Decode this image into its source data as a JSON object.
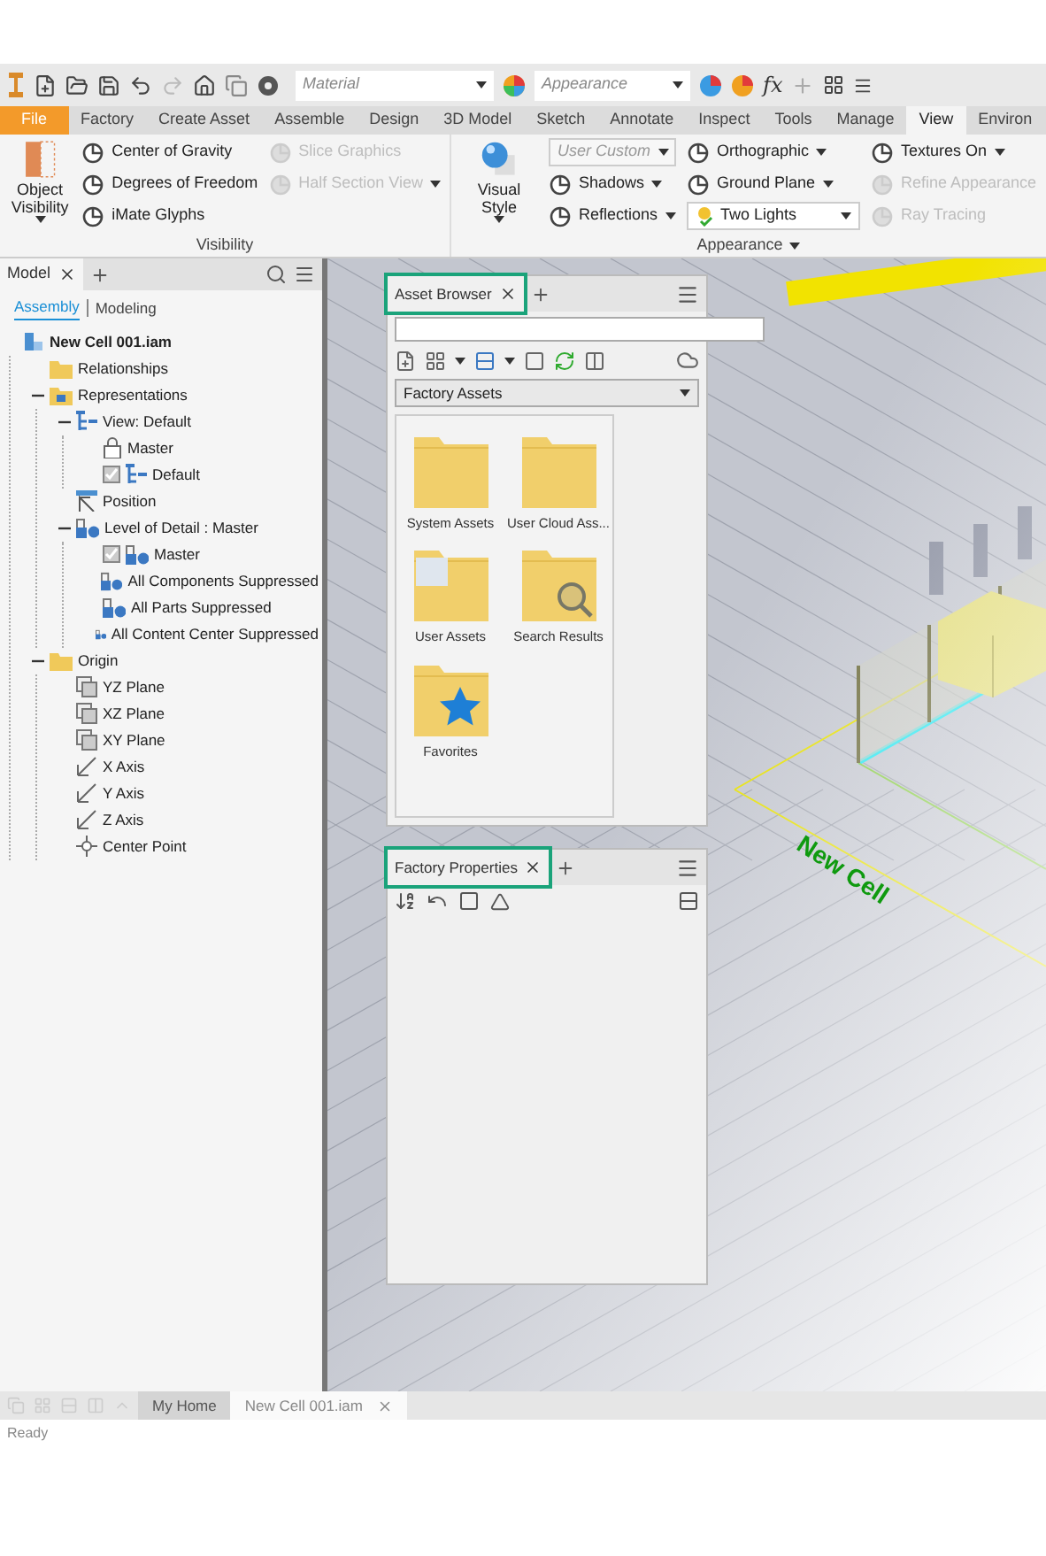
{
  "quick_access": {
    "material": "Material",
    "appearance": "Appearance",
    "fx": "fx"
  },
  "ribbon_tabs": [
    {
      "label": "File",
      "kind": "file",
      "selected": false
    },
    {
      "label": "Factory",
      "kind": "tab",
      "selected": false
    },
    {
      "label": "Create Asset",
      "kind": "tab",
      "selected": false
    },
    {
      "label": "Assemble",
      "kind": "tab",
      "selected": false
    },
    {
      "label": "Design",
      "kind": "tab",
      "selected": false
    },
    {
      "label": "3D Model",
      "kind": "tab",
      "selected": false
    },
    {
      "label": "Sketch",
      "kind": "tab",
      "selected": false
    },
    {
      "label": "Annotate",
      "kind": "tab",
      "selected": false
    },
    {
      "label": "Inspect",
      "kind": "tab",
      "selected": false
    },
    {
      "label": "Tools",
      "kind": "tab",
      "selected": false
    },
    {
      "label": "Manage",
      "kind": "tab",
      "selected": false
    },
    {
      "label": "View",
      "kind": "tab",
      "selected": true
    },
    {
      "label": "Environ",
      "kind": "tab",
      "selected": false
    }
  ],
  "ribbon_panels": [
    {
      "title": "Visibility",
      "title_menu": false,
      "big_button": {
        "label": "Object Visibility",
        "kind": "visibility"
      },
      "columns": [
        [
          {
            "label": "Center of Gravity",
            "kind": "button",
            "disabled": false,
            "menu": false
          },
          {
            "label": "Degrees of Freedom",
            "kind": "button",
            "disabled": false,
            "menu": false
          },
          {
            "label": "iMate Glyphs",
            "kind": "button",
            "disabled": false,
            "menu": false
          }
        ],
        [
          {
            "label": "Slice Graphics",
            "kind": "button",
            "disabled": true,
            "menu": false
          },
          {
            "label": "Half Section View",
            "kind": "button",
            "disabled": true,
            "menu": true
          }
        ]
      ]
    },
    {
      "title": "Appearance",
      "title_menu": true,
      "big_button": {
        "label": "Visual Style",
        "kind": "sphere"
      },
      "columns": [
        [
          {
            "label": "User Custom",
            "kind": "combo",
            "disabled": false,
            "menu": true
          },
          {
            "label": "Shadows",
            "kind": "button",
            "disabled": false,
            "menu": true
          },
          {
            "label": "Reflections",
            "kind": "button",
            "disabled": false,
            "menu": true
          }
        ],
        [
          {
            "label": "Orthographic",
            "kind": "button",
            "disabled": false,
            "menu": true
          },
          {
            "label": "Ground Plane",
            "kind": "button",
            "disabled": false,
            "menu": true
          },
          {
            "label": "Two Lights",
            "kind": "select",
            "disabled": false,
            "menu": true
          }
        ],
        [
          {
            "label": "Textures On",
            "kind": "button",
            "disabled": false,
            "menu": true
          },
          {
            "label": "Refine Appearance",
            "kind": "button",
            "disabled": true,
            "menu": false
          },
          {
            "label": "Ray Tracing",
            "kind": "button",
            "disabled": true,
            "menu": false
          }
        ]
      ]
    }
  ],
  "model_browser": {
    "tab": "Model",
    "modes": [
      {
        "label": "Assembly",
        "selected": true
      },
      {
        "label": "Modeling",
        "selected": false
      }
    ],
    "tree": [
      {
        "label": "New Cell 001.iam",
        "kind": "assembly",
        "children": [
          {
            "label": "Relationships",
            "kind": "folder"
          },
          {
            "label": "Representations",
            "kind": "repfolder",
            "expanded": true,
            "children": [
              {
                "label": "View: Default",
                "kind": "view",
                "expanded": true,
                "children": [
                  {
                    "label": "Master",
                    "kind": "lock"
                  },
                  {
                    "label": "Default",
                    "kind": "view",
                    "checked": true
                  }
                ]
              },
              {
                "label": "Position",
                "kind": "position"
              },
              {
                "label": "Level of Detail : Master",
                "kind": "lod",
                "expanded": true,
                "children": [
                  {
                    "label": "Master",
                    "kind": "lod",
                    "checked": true
                  },
                  {
                    "label": "All Components Suppressed",
                    "kind": "lod"
                  },
                  {
                    "label": "All Parts Suppressed",
                    "kind": "lod"
                  },
                  {
                    "label": "All Content Center Suppressed",
                    "kind": "lod"
                  }
                ]
              }
            ]
          },
          {
            "label": "Origin",
            "kind": "folder",
            "expanded": true,
            "children": [
              {
                "label": "YZ Plane",
                "kind": "plane"
              },
              {
                "label": "XZ Plane",
                "kind": "plane"
              },
              {
                "label": "XY Plane",
                "kind": "plane"
              },
              {
                "label": "X Axis",
                "kind": "axis"
              },
              {
                "label": "Y Axis",
                "kind": "axis"
              },
              {
                "label": "Z Axis",
                "kind": "axis"
              },
              {
                "label": "Center Point",
                "kind": "point"
              }
            ]
          }
        ]
      }
    ]
  },
  "asset_browser": {
    "tab": "Asset Browser",
    "library": "Factory Assets",
    "items": [
      {
        "label": "System Assets",
        "kind": "folder"
      },
      {
        "label": "User Cloud Ass...",
        "kind": "folder"
      },
      {
        "label": "User Assets",
        "kind": "user"
      },
      {
        "label": "Search Results",
        "kind": "search"
      },
      {
        "label": "Favorites",
        "kind": "favorites"
      }
    ]
  },
  "factory_properties": {
    "tab": "Factory Properties"
  },
  "viewport": {
    "label": "New Cell"
  },
  "document_tabs": [
    {
      "label": "My Home",
      "selected": false
    },
    {
      "label": "New Cell 001.iam",
      "selected": true
    }
  ],
  "status_bar": "Ready"
}
